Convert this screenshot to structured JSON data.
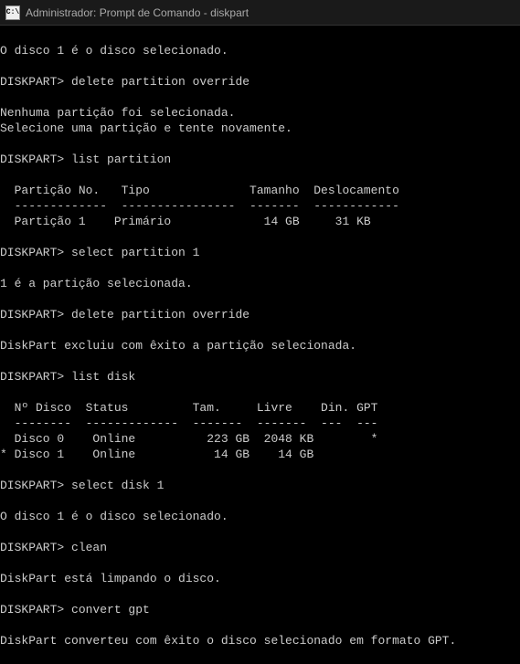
{
  "titlebar": {
    "icon_label": "C:\\",
    "title": "Administrador: Prompt de Comando - diskpart"
  },
  "lines": [
    "",
    "O disco 1 é o disco selecionado.",
    "",
    "DISKPART> delete partition override",
    "",
    "Nenhuma partição foi selecionada.",
    "Selecione uma partição e tente novamente.",
    "",
    "DISKPART> list partition",
    "",
    "  Partição No.   Tipo              Tamanho  Deslocamento",
    "  -------------  ----------------  -------  ------------",
    "  Partição 1    Primário             14 GB     31 KB",
    "",
    "DISKPART> select partition 1",
    "",
    "1 é a partição selecionada.",
    "",
    "DISKPART> delete partition override",
    "",
    "DiskPart excluiu com êxito a partição selecionada.",
    "",
    "DISKPART> list disk",
    "",
    "  Nº Disco  Status         Tam.     Livre    Din. GPT",
    "  --------  -------------  -------  -------  ---  ---",
    "  Disco 0    Online          223 GB  2048 KB        *",
    "* Disco 1    Online           14 GB    14 GB",
    "",
    "DISKPART> select disk 1",
    "",
    "O disco 1 é o disco selecionado.",
    "",
    "DISKPART> clean",
    "",
    "DiskPart está limpando o disco.",
    "",
    "DISKPART> convert gpt",
    "",
    "DiskPart converteu com êxito o disco selecionado em formato GPT.",
    ""
  ]
}
